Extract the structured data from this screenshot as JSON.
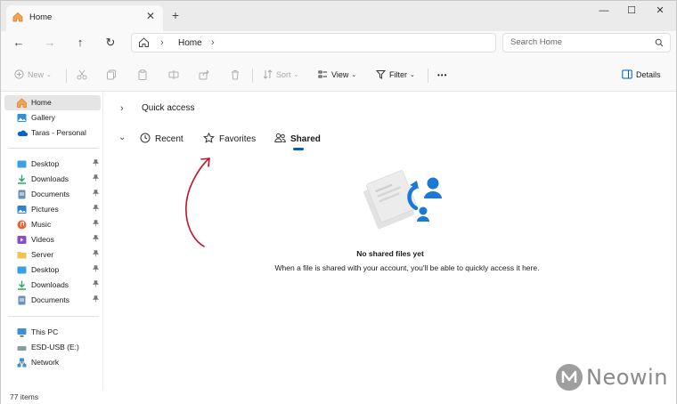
{
  "window": {
    "tab_title": "Home",
    "tab_close": "✕",
    "new_tab": "+",
    "minimize": "—",
    "maximize": "☐",
    "close": "✕"
  },
  "nav": {
    "back": "←",
    "forward": "→",
    "up": "↑",
    "refresh": "↻",
    "address": {
      "sep": "›",
      "location": "Home"
    },
    "search_placeholder": "Search Home"
  },
  "toolbar": {
    "new_label": "New",
    "sort_label": "Sort",
    "view_label": "View",
    "filter_label": "Filter",
    "more_label": "•••",
    "details_label": "Details",
    "chevron": "⌄"
  },
  "sidebar": {
    "pin": "📌",
    "items": [
      {
        "label": "Home",
        "icon": "home-icon",
        "selected": true
      },
      {
        "label": "Gallery",
        "icon": "gallery-icon"
      },
      {
        "label": "Taras - Personal",
        "icon": "onedrive-icon"
      },
      {
        "label": "Desktop",
        "icon": "desktop-icon",
        "pinned": true
      },
      {
        "label": "Downloads",
        "icon": "downloads-icon",
        "pinned": true
      },
      {
        "label": "Documents",
        "icon": "documents-icon",
        "pinned": true
      },
      {
        "label": "Pictures",
        "icon": "pictures-icon",
        "pinned": true
      },
      {
        "label": "Music",
        "icon": "music-icon",
        "pinned": true
      },
      {
        "label": "Videos",
        "icon": "videos-icon",
        "pinned": true
      },
      {
        "label": "Server",
        "icon": "folder-icon",
        "pinned": true
      },
      {
        "label": "Desktop",
        "icon": "desktop-icon",
        "pinned": true
      },
      {
        "label": "Downloads",
        "icon": "downloads-icon",
        "pinned": true
      },
      {
        "label": "Documents",
        "icon": "documents-icon",
        "pinned": true
      },
      {
        "label": "This PC",
        "icon": "pc-icon"
      },
      {
        "label": "ESD-USB (E:)",
        "icon": "drive-icon"
      },
      {
        "label": "Network",
        "icon": "network-icon"
      }
    ]
  },
  "main": {
    "section_chevron": "›",
    "section_title": "Quick access",
    "tab_chevron": "⌄",
    "tabs": [
      {
        "label": "Recent"
      },
      {
        "label": "Favorites"
      },
      {
        "label": "Shared",
        "active": true
      }
    ],
    "empty_title": "No shared files yet",
    "empty_desc": "When a file is shared with your account, you'll be able to quickly access it here."
  },
  "status": {
    "item_count": "77 items"
  },
  "watermark": {
    "text": "Neowin"
  },
  "colors": {
    "accent": "#005fb8",
    "annotation": "#c0142a",
    "selected_bg": "#e5e5e5"
  }
}
